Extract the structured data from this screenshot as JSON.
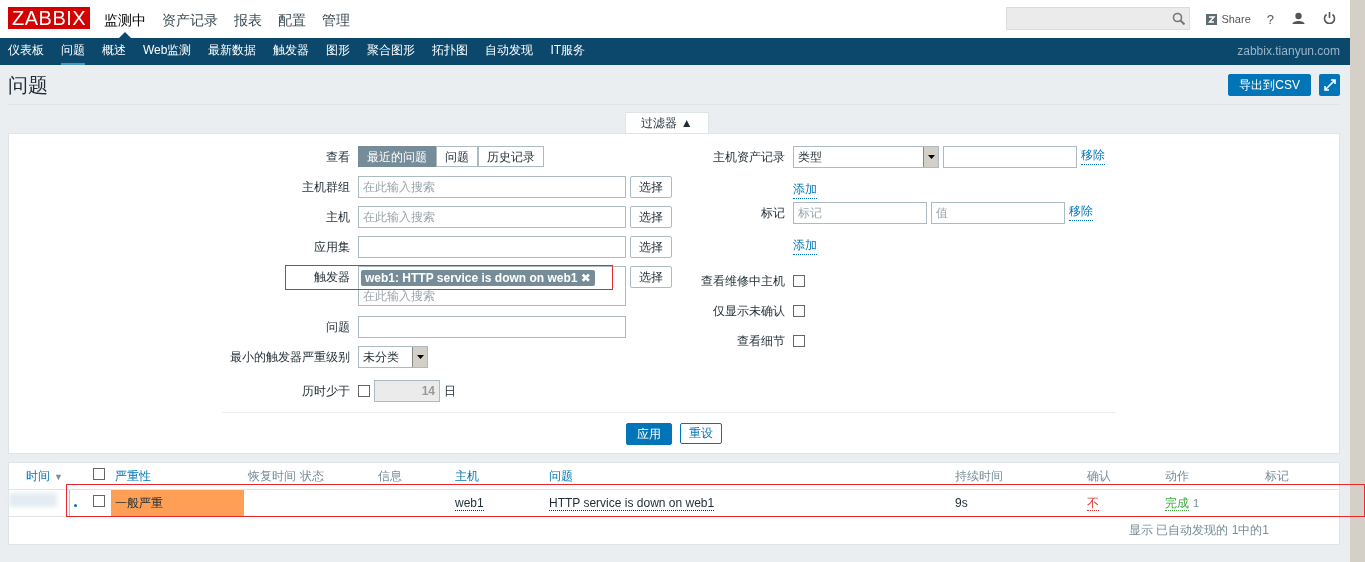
{
  "header": {
    "logo": "ZABBIX",
    "menu": [
      {
        "label": "监测中",
        "selected": true
      },
      {
        "label": "资产记录",
        "selected": false
      },
      {
        "label": "报表",
        "selected": false
      },
      {
        "label": "配置",
        "selected": false
      },
      {
        "label": "管理",
        "selected": false
      }
    ],
    "share": "Share",
    "help": "?"
  },
  "subnav": {
    "items": [
      {
        "label": "仪表板",
        "selected": false
      },
      {
        "label": "问题",
        "selected": true
      },
      {
        "label": "概述",
        "selected": false
      },
      {
        "label": "Web监测",
        "selected": false
      },
      {
        "label": "最新数据",
        "selected": false
      },
      {
        "label": "触发器",
        "selected": false
      },
      {
        "label": "图形",
        "selected": false
      },
      {
        "label": "聚合图形",
        "selected": false
      },
      {
        "label": "拓扑图",
        "selected": false
      },
      {
        "label": "自动发现",
        "selected": false
      },
      {
        "label": "IT服务",
        "selected": false
      }
    ],
    "server": "zabbix.tianyun.com"
  },
  "page": {
    "title": "问题",
    "export_button": "导出到CSV"
  },
  "filter": {
    "tab_label": "过滤器",
    "tab_arrow": "▲",
    "view": {
      "label": "查看",
      "options": [
        {
          "label": "最近的问题",
          "selected": true
        },
        {
          "label": "问题",
          "selected": false
        },
        {
          "label": "历史记录",
          "selected": false
        }
      ]
    },
    "host_groups": {
      "label": "主机群组",
      "placeholder": "在此输入搜索",
      "button": "选择"
    },
    "hosts": {
      "label": "主机",
      "placeholder": "在此输入搜索",
      "button": "选择"
    },
    "applications": {
      "label": "应用集",
      "button": "选择"
    },
    "triggers": {
      "label": "触发器",
      "tag": "web1: HTTP service is down on web1",
      "tag_remove": "✖",
      "placeholder": "在此输入搜索",
      "button": "选择"
    },
    "problem": {
      "label": "问题"
    },
    "min_severity": {
      "label": "最小的触发器严重级别",
      "value": "未分类"
    },
    "age": {
      "label": "历时少于",
      "checked": false,
      "value": "14",
      "unit": "日"
    },
    "inventory": {
      "label": "主机资产记录",
      "type": "类型",
      "remove": "移除",
      "add": "添加"
    },
    "tags": {
      "label": "标记",
      "tag_placeholder": "标记",
      "value_placeholder": "值",
      "remove": "移除",
      "add": "添加"
    },
    "checks": [
      {
        "label": "查看维修中主机",
        "checked": false
      },
      {
        "label": "仅显示未确认",
        "checked": false
      },
      {
        "label": "查看细节",
        "checked": false
      }
    ],
    "apply": "应用",
    "reset": "重设"
  },
  "table": {
    "columns": [
      {
        "label": "时间",
        "sortable": true,
        "sort_arrow": "▼"
      },
      {
        "label": "严重性",
        "sortable": true
      },
      {
        "label": "恢复时间",
        "sortable": false
      },
      {
        "label": "状态",
        "sortable": false
      },
      {
        "label": "信息",
        "sortable": false
      },
      {
        "label": "主机",
        "sortable": true
      },
      {
        "label": "问题",
        "sortable": true
      },
      {
        "label": "持续时间",
        "sortable": false
      },
      {
        "label": "确认",
        "sortable": false
      },
      {
        "label": "动作",
        "sortable": false
      },
      {
        "label": "标记",
        "sortable": false
      }
    ],
    "select_all": false,
    "rows": [
      {
        "checked": false,
        "unacknowledged_marker": true,
        "severity": "一般严重",
        "color": "#ff9f55",
        "host": "web1",
        "problem": "HTTP service is down on web1",
        "duration": "9s",
        "ack": "不",
        "acknowledged": false,
        "action": "完成",
        "action_count": "1"
      }
    ],
    "footer": "显示 已自动发现的 1中的1"
  }
}
